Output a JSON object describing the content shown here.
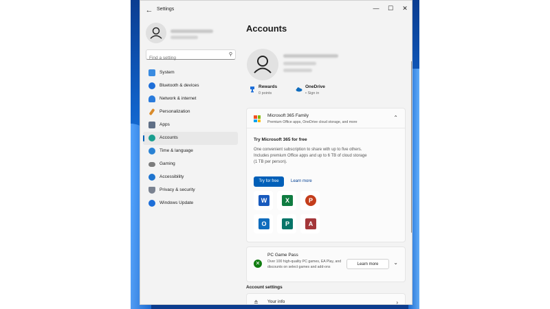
{
  "window": {
    "title": "Settings",
    "back_icon": "arrow-left-icon",
    "minimize": "—",
    "maximize": "☐",
    "close": "✕"
  },
  "sidebar": {
    "search": {
      "placeholder": "Find a setting",
      "icon": "search-icon"
    },
    "items": [
      {
        "label": "System",
        "icon": "monitor-icon",
        "color": "#3a8be0"
      },
      {
        "label": "Bluetooth & devices",
        "icon": "bluetooth-icon",
        "color": "#1d6ed8"
      },
      {
        "label": "Network & internet",
        "icon": "wifi-icon",
        "color": "#2a7bdc"
      },
      {
        "label": "Personalization",
        "icon": "brush-icon",
        "color": "#d98b2b"
      },
      {
        "label": "Apps",
        "icon": "apps-icon",
        "color": "#5f6f86"
      },
      {
        "label": "Accounts",
        "icon": "person-icon",
        "color": "#1a9e8f",
        "active": true
      },
      {
        "label": "Time & language",
        "icon": "globe-clock-icon",
        "color": "#2a82d4"
      },
      {
        "label": "Gaming",
        "icon": "gamepad-icon",
        "color": "#7c7c7c"
      },
      {
        "label": "Accessibility",
        "icon": "accessibility-icon",
        "color": "#1e74cf"
      },
      {
        "label": "Privacy & security",
        "icon": "shield-icon",
        "color": "#7a8290"
      },
      {
        "label": "Windows Update",
        "icon": "update-icon",
        "color": "#1d6ed8"
      }
    ]
  },
  "main": {
    "title": "Accounts",
    "rewards": {
      "title": "Rewards",
      "sub": "0 points"
    },
    "onedrive": {
      "title": "OneDrive",
      "sub": "• Sign in"
    },
    "ms365": {
      "title": "Microsoft 365 Family",
      "desc": "Premium Office apps, OneDrive cloud storage, and more",
      "try_title": "Try Microsoft 365 for free",
      "try_body": "One convenient subscription to share with up to five others. Includes premium Office apps and up to 6 TB of cloud storage (1 TB per person).",
      "primary_button": "Try for free",
      "link_button": "Learn more",
      "apps": [
        {
          "letter": "W",
          "name": "word-icon",
          "color": "#185abd"
        },
        {
          "letter": "X",
          "name": "excel-icon",
          "color": "#107c41"
        },
        {
          "letter": "P",
          "name": "powerpoint-icon",
          "color": "#c43e1c"
        },
        {
          "letter": "O",
          "name": "outlook-icon",
          "color": "#0f6cbd"
        },
        {
          "letter": "P",
          "name": "publisher-icon",
          "color": "#077568"
        },
        {
          "letter": "A",
          "name": "access-icon",
          "color": "#a4373a"
        }
      ]
    },
    "gamepass": {
      "title": "PC Game Pass",
      "desc": "Over 100 high-quality PC games, EA Play, and discounts on select games and add-ons",
      "button": "Learn more"
    },
    "account_settings": {
      "heading": "Account settings",
      "your_info": "Your info"
    }
  }
}
